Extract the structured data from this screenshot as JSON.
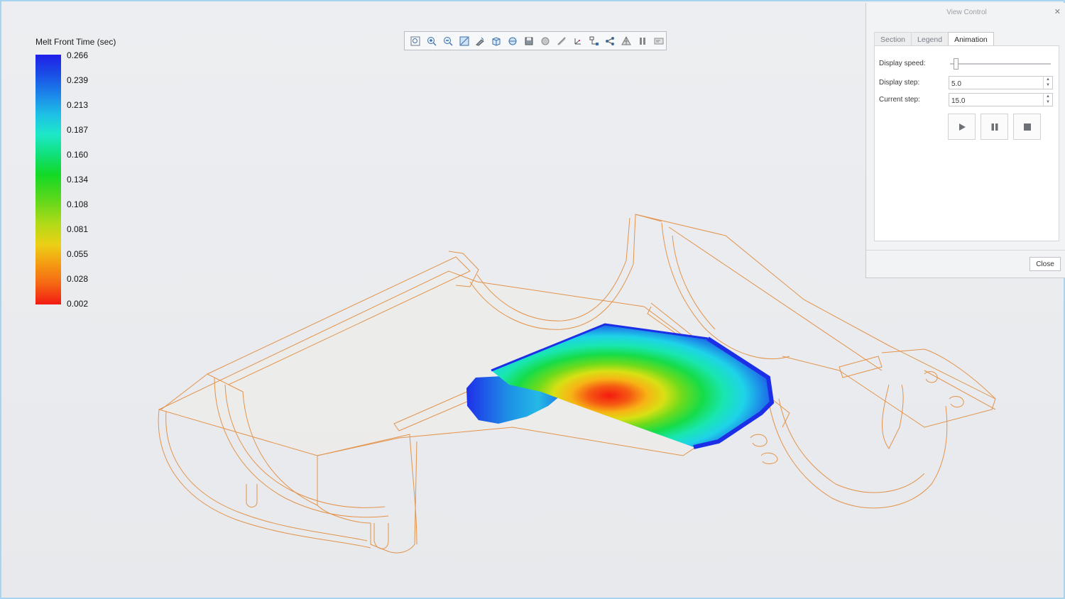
{
  "legend": {
    "title": "Melt Front Time (sec)",
    "values": [
      "0.266",
      "0.239",
      "0.213",
      "0.187",
      "0.160",
      "0.134",
      "0.108",
      "0.081",
      "0.055",
      "0.028",
      "0.002"
    ],
    "color_top": "#1f1fe8",
    "color_bottom": "#f21a12"
  },
  "toolbar": {
    "icons": [
      "zoom-fit-icon",
      "zoom-in-icon",
      "zoom-out-icon",
      "pan-icon",
      "rotate-icon",
      "cube-view-icon",
      "orient-icon",
      "save-view-icon",
      "shade-icon",
      "section-icon",
      "axes-icon",
      "tree-icon",
      "node-icon",
      "mesh-icon",
      "pause-icon",
      "export-icon"
    ]
  },
  "panel": {
    "title": "View Control",
    "tabs": [
      "Section",
      "Legend",
      "Animation"
    ],
    "active_tab": "Animation",
    "display_speed_label": "Display speed:",
    "display_speed_fraction": 0.05,
    "display_step_label": "Display step:",
    "display_step_value": "5.0",
    "current_step_label": "Current step:",
    "current_step_value": "15.0",
    "close_label": "Close"
  },
  "colors": {
    "background": "#e9ebee",
    "wireframe": "#e38a3a",
    "accent_border": "#a9d4ef"
  }
}
